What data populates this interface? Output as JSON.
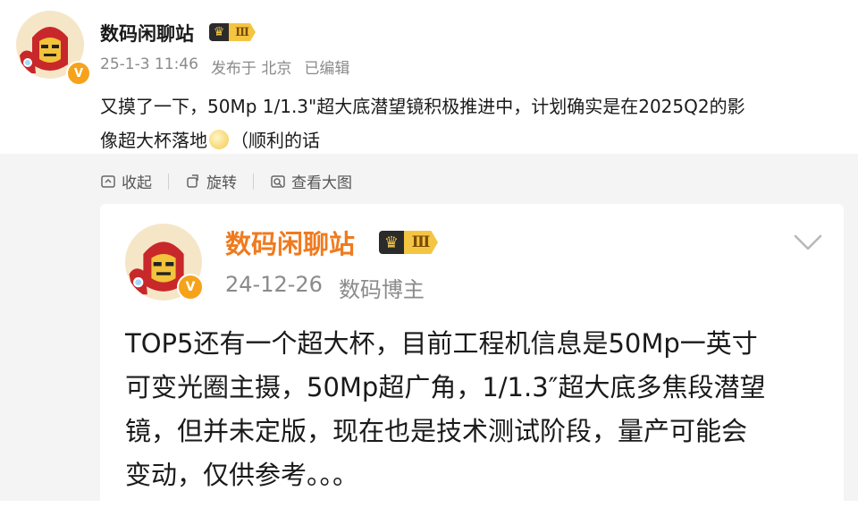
{
  "post": {
    "author": "数码闲聊站",
    "level": "Ⅲ",
    "verified_badge": "V",
    "date": "25-1-3 11:46",
    "location": "发布于 北京",
    "edited": "已编辑",
    "text_line1": "又摸了一下，50Mp 1/1.3\"超大底潜望镜积极推进中，计划确实是在2025Q2的影",
    "text_line2_a": "像超大杯落地",
    "text_line2_b": "（顺利的话",
    "emoji_icon": "pudding-emoji-icon"
  },
  "actions": {
    "collapse": "收起",
    "rotate": "旋转",
    "view_large": "查看大图"
  },
  "retweet": {
    "author": "数码闲聊站",
    "level": "Ⅲ",
    "verified_badge": "V",
    "date": "24-12-26",
    "role": "数码博主",
    "lines": [
      "TOP5还有一个超大杯，目前工程机信息是50Mp一英寸",
      "可变光圈主摄，50Mp超广角，1/1.3″超大底多焦段潜望",
      "镜，但并未定版，现在也是技术测试阶段，量产可能会",
      "变动，仅供参考。。。"
    ]
  },
  "colors": {
    "accent_orange": "#f07a1e",
    "badge": "#f7a21b",
    "panel_bg": "#f4f4f4"
  }
}
